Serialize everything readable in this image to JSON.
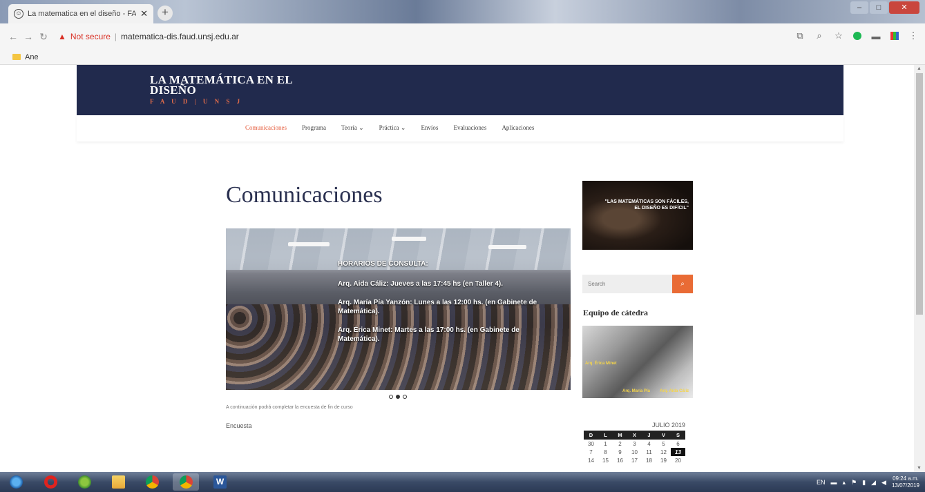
{
  "browser": {
    "tab_title": "La matematica en el diseño - FA",
    "not_secure": "Not secure",
    "url": "matematica-dis.faud.unsj.edu.ar",
    "bookmark": "Ane"
  },
  "site": {
    "logo_line1": "LA MATEMÁTICA EN EL",
    "logo_line2": "DISEÑO",
    "logo_sub": "F A U D | U N S J",
    "menu": [
      "Comunicaciones",
      "Programa",
      "Teoría ⌄",
      "Práctica ⌄",
      "Envíos",
      "Evaluaciones",
      "Aplicaciones"
    ]
  },
  "main": {
    "title": "Comunicaciones",
    "slider": {
      "heading": "HORARIOS DE CONSULTA:",
      "line1": "Arq. Aida Cáliz: Jueves a las 17:45 hs (en Taller 4).",
      "line2": "Arq. María Pía Yanzón: Lunes a las 12:00 hs. (en Gabinete de Matemática).",
      "line3": "Arq. Érica Minet: Martes a las 17:00 hs. (en Gabinete de Matemática)."
    },
    "caption": "A continuación podrá completar la encuesta de fin de curso",
    "encuesta": "Encuesta"
  },
  "sidebar": {
    "quote_line1": "\"LAS MATEMÁTICAS SON FÁCILES,",
    "quote_line2": "EL DISEÑO ES DIFÍCIL\"",
    "search_placeholder": "Search",
    "equipo": "Equipo de cátedra",
    "calendar": {
      "month": "JULIO 2019",
      "days": [
        "D",
        "L",
        "M",
        "X",
        "J",
        "V",
        "S"
      ],
      "weeks": [
        [
          "30",
          "1",
          "2",
          "3",
          "4",
          "5",
          "6"
        ],
        [
          "7",
          "8",
          "9",
          "10",
          "11",
          "12",
          "13"
        ],
        [
          "14",
          "15",
          "16",
          "17",
          "18",
          "19",
          "20"
        ]
      ],
      "today": "13"
    }
  },
  "taskbar": {
    "lang": "EN",
    "time": "09:24 a.m.",
    "date": "13/07/2019"
  }
}
